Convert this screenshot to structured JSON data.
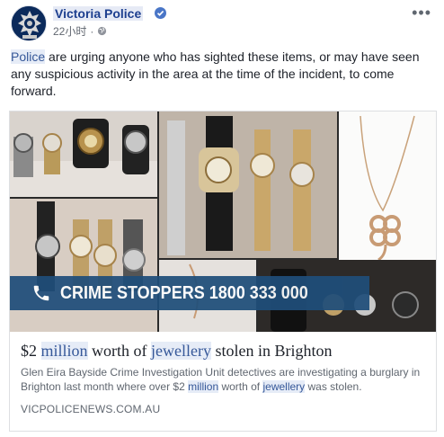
{
  "header": {
    "page_name": "Victoria Police",
    "timestamp": "22小时",
    "separator": "·"
  },
  "post": {
    "text_hl1": "Police",
    "text_rest": " are urging anyone who has sighted these items, or may have seen any suspicious activity in the area at the time of the incident, to come forward."
  },
  "link_card": {
    "banner_text": "CRIME STOPPERS  1800 333 000",
    "title_parts": [
      "$2 ",
      "million",
      " worth of ",
      "jewellery",
      " stolen in Brighton"
    ],
    "desc_parts": [
      "Glen Eira Bayside Crime Investigation Unit detectives are investigating a burglary in Brighton last month where over $2 ",
      "million",
      " worth of ",
      "jewellery",
      " was stolen."
    ],
    "domain": "VICPOLICENEWS.COM.AU"
  },
  "colors": {
    "brand_blue": "#1d3f8f",
    "banner_blue": "#1f4e7a",
    "highlight_bg": "#e6ecf7"
  }
}
